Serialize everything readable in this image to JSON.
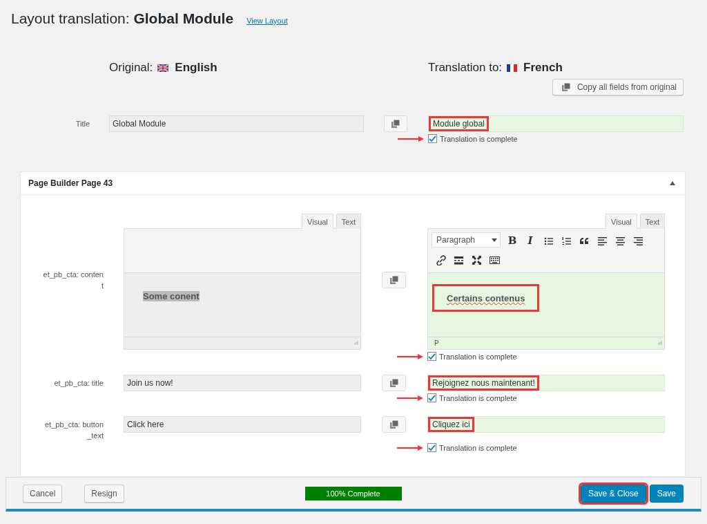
{
  "header": {
    "title": "Layout translation: **Global Module**",
    "link": "View Layout"
  },
  "original": {
    "label": "Original:",
    "language": "English"
  },
  "translation": {
    "label": "Translation to:",
    "language": "French"
  },
  "copy_all_button": "Copy all fields from original",
  "title_field": {
    "kind": "text",
    "label": "Title",
    "original": "Global Module",
    "translation": "Module global",
    "highlighted": true,
    "complete": true,
    "complete_label": "Translation is complete",
    "arrow": true
  },
  "panel": {
    "title": "Page Builder Page 43",
    "expanded": true,
    "fields": [
      {
        "kind": "editor",
        "label": "et_pb_cta: content",
        "original": {
          "tabs": [
            {
              "label": "Visual",
              "selected": true
            },
            {
              "label": "Text",
              "selected": false
            }
          ],
          "text": "Some conent",
          "text_selected": true
        },
        "translation": {
          "tabs": [
            {
              "label": "Visual",
              "selected": true
            },
            {
              "label": "Text",
              "selected": false
            }
          ],
          "format": "Paragraph",
          "toolbar": [
            {
              "kind": "bold",
              "glyph": "B"
            },
            {
              "kind": "italic",
              "glyph": "I"
            },
            {
              "kind": "bullet-list"
            },
            {
              "kind": "numbered-list"
            },
            {
              "kind": "quote"
            },
            {
              "kind": "align-left"
            },
            {
              "kind": "align-center"
            },
            {
              "kind": "align-right"
            },
            {
              "kind": "link"
            },
            {
              "kind": "read-more"
            },
            {
              "kind": "fullscreen"
            },
            {
              "kind": "keyboard"
            }
          ],
          "text": "Certains contenus",
          "spellcheck_error": true,
          "status": "P"
        },
        "highlighted": true,
        "complete": true,
        "complete_label": "Translation is complete",
        "arrow": true
      },
      {
        "kind": "text",
        "label": "et_pb_cta: title",
        "original": "Join us now!",
        "translation": "Rejoignez nous maintenant!",
        "highlighted": true,
        "complete": true,
        "complete_label": "Translation is complete",
        "arrow": true
      },
      {
        "kind": "text",
        "label": "et_pb_cta: button_text",
        "original": "Click here",
        "translation": "Cliquez ici",
        "highlighted": true,
        "complete": true,
        "complete_label": "Translation is complete",
        "arrow": true
      }
    ]
  },
  "footer": {
    "buttons_left": [
      "Cancel",
      "Resign"
    ],
    "progress": {
      "level": 1,
      "text": "100% Complete"
    },
    "buttons_right": [
      {
        "label": "Save & Close",
        "highlighted": true
      },
      {
        "label": "Save",
        "highlighted": false
      }
    ]
  }
}
